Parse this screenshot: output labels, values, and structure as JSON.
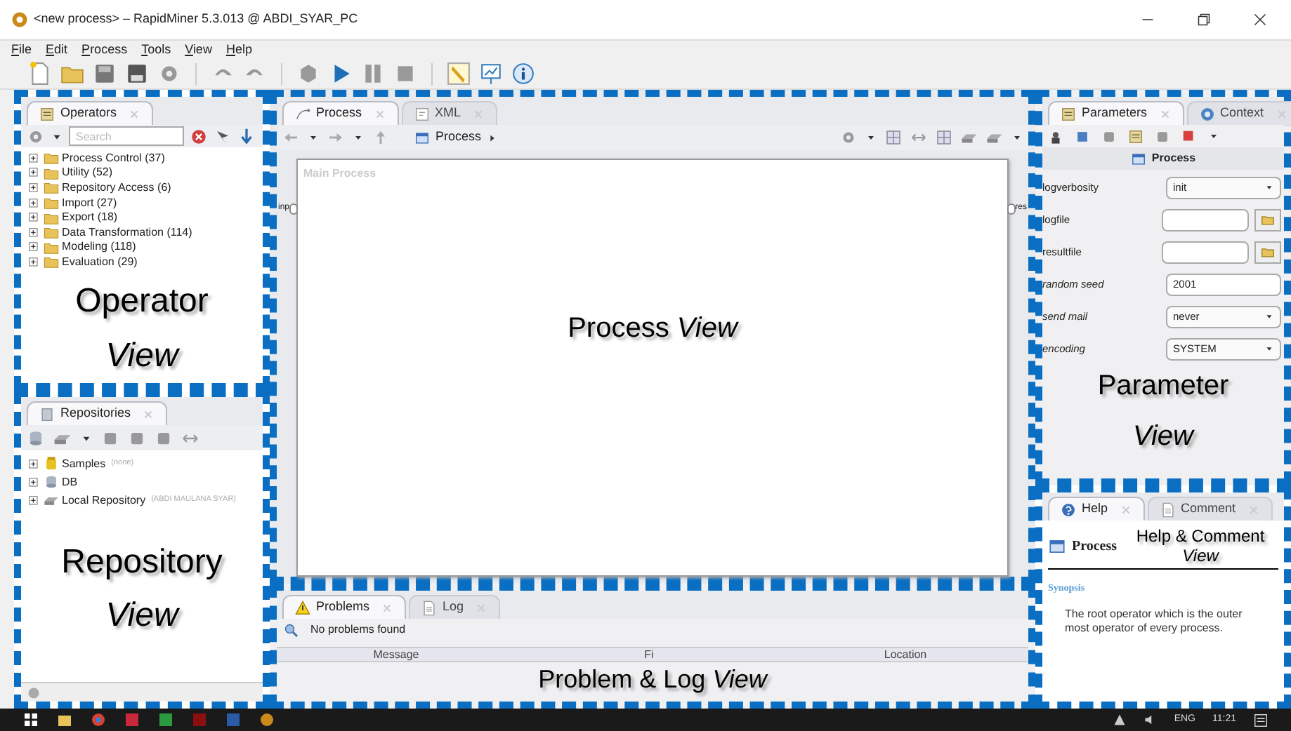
{
  "window": {
    "title": "<new process> – RapidMiner 5.3.013 @ ABDI_SYAR_PC"
  },
  "menu": [
    "File",
    "Edit",
    "Process",
    "Tools",
    "View",
    "Help"
  ],
  "operators_view": {
    "tabs": [
      {
        "label": "Operators",
        "selected": true
      }
    ],
    "search": {
      "placeholder": "Search"
    },
    "tree": [
      {
        "label": "Process Control (37)"
      },
      {
        "label": "Utility (52)"
      },
      {
        "label": "Repository Access (6)"
      },
      {
        "label": "Import (27)"
      },
      {
        "label": "Export (18)"
      },
      {
        "label": "Data Transformation (114)"
      },
      {
        "label": "Modeling (118)"
      },
      {
        "label": "Evaluation (29)"
      }
    ],
    "annotation": "Operator *View*"
  },
  "repositories_view": {
    "tabs": [
      {
        "label": "Repositories",
        "selected": true
      }
    ],
    "tree": [
      {
        "label": "Samples",
        "note": "(none)"
      },
      {
        "label": "DB"
      },
      {
        "label": "Local Repository",
        "note": "(ABDI MAULANA SYAR)"
      }
    ],
    "annotation": "Repository *View*"
  },
  "process_view": {
    "tabs": [
      {
        "label": "Process",
        "selected": true
      },
      {
        "label": "XML",
        "selected": false
      }
    ],
    "breadcrumb": "Process",
    "canvas_title": "Main Process",
    "input_port": "inp",
    "result_port": "res",
    "annotation": "Process *View*"
  },
  "parameters_view": {
    "tabs": [
      {
        "label": "Parameters",
        "selected": true
      },
      {
        "label": "Context",
        "selected": false
      }
    ],
    "operator": "Process",
    "parameters": [
      {
        "kind": "select",
        "label": "logverbosity",
        "value": "init",
        "expert": false
      },
      {
        "kind": "file",
        "label": "logfile",
        "expert": false
      },
      {
        "kind": "file",
        "label": "resultfile",
        "expert": false
      },
      {
        "kind": "text",
        "label": "random seed",
        "value": "2001",
        "expert": true
      },
      {
        "kind": "select",
        "label": "send mail",
        "value": "never",
        "expert": true
      },
      {
        "kind": "select",
        "label": "encoding",
        "value": "SYSTEM",
        "expert": true
      }
    ],
    "annotation": "Parameter *View*"
  },
  "problems_view": {
    "tabs": [
      {
        "label": "Problems",
        "selected": true
      },
      {
        "label": "Log",
        "selected": false
      }
    ],
    "status": "No problems found",
    "columns": [
      "Message",
      "Fi",
      "Location"
    ],
    "annotation": "Problem & Log *View*"
  },
  "help_view": {
    "tabs": [
      {
        "label": "Help",
        "selected": true
      },
      {
        "label": "Comment",
        "selected": false
      }
    ],
    "heading": "Process",
    "section": "Synopsis",
    "description": "The root operator which is the outer most operator of every process.",
    "annotation": "Help & Comment *View*"
  },
  "taskbar": {
    "language": "ENG",
    "time": "11:21"
  }
}
